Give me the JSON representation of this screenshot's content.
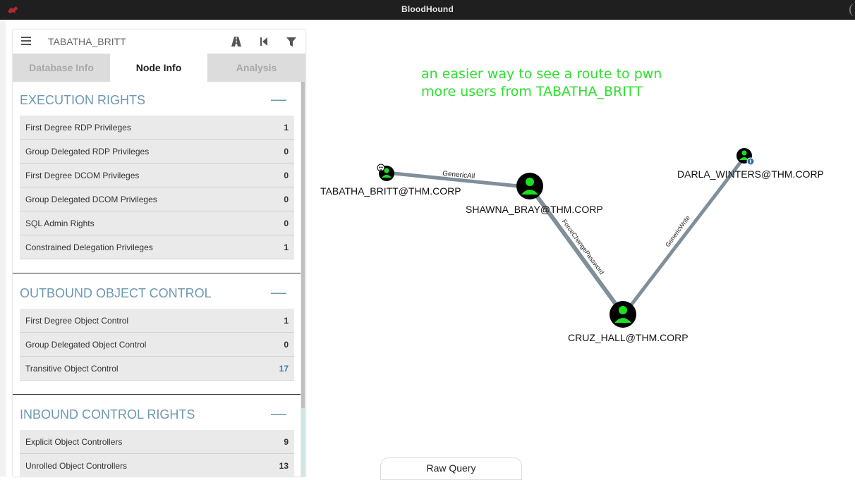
{
  "window": {
    "title": "BloodHound"
  },
  "search": {
    "value": "TABATHA_BRITT"
  },
  "tabs": [
    {
      "label": "Database Info"
    },
    {
      "label": "Node Info"
    },
    {
      "label": "Analysis"
    }
  ],
  "sections": {
    "execution": {
      "title": "EXECUTION RIGHTS",
      "collapse": "—",
      "rows": [
        {
          "label": "First Degree RDP Privileges",
          "value": "1"
        },
        {
          "label": "Group Delegated RDP Privileges",
          "value": "0"
        },
        {
          "label": "First Degree DCOM Privileges",
          "value": "0"
        },
        {
          "label": "Group Delegated DCOM Privileges",
          "value": "0"
        },
        {
          "label": "SQL Admin Rights",
          "value": "0"
        },
        {
          "label": "Constrained Delegation Privileges",
          "value": "1"
        }
      ]
    },
    "outbound": {
      "title": "OUTBOUND OBJECT CONTROL",
      "collapse": "—",
      "rows": [
        {
          "label": "First Degree Object Control",
          "value": "1"
        },
        {
          "label": "Group Delegated Object Control",
          "value": "0"
        },
        {
          "label": "Transitive Object Control",
          "value": "17"
        }
      ]
    },
    "inbound": {
      "title": "INBOUND CONTROL RIGHTS",
      "collapse": "—",
      "rows": [
        {
          "label": "Explicit Object Controllers",
          "value": "9"
        },
        {
          "label": "Unrolled Object Controllers",
          "value": "13"
        }
      ]
    }
  },
  "graph": {
    "annotation": "an easier way to see a route to pwn more users from TABATHA_BRITT",
    "nodes": {
      "tabatha": "TABATHA_BRITT@THM.CORP",
      "shawna": "SHAWNA_BRAY@THM.CORP",
      "darla": "DARLA_WINTERS@THM.CORP",
      "cruz": "CRUZ_HALL@THM.CORP"
    },
    "edges": {
      "genericall": "GenericAll",
      "forcechange": "ForceChangePassword",
      "genericwrite": "GenericWrite"
    },
    "colors": {
      "node_fill": "#1ee01e",
      "node_bg": "#000000",
      "edge": "#808f99",
      "annotation": "#2ee02e"
    }
  },
  "raw_query": {
    "label": "Raw Query"
  }
}
